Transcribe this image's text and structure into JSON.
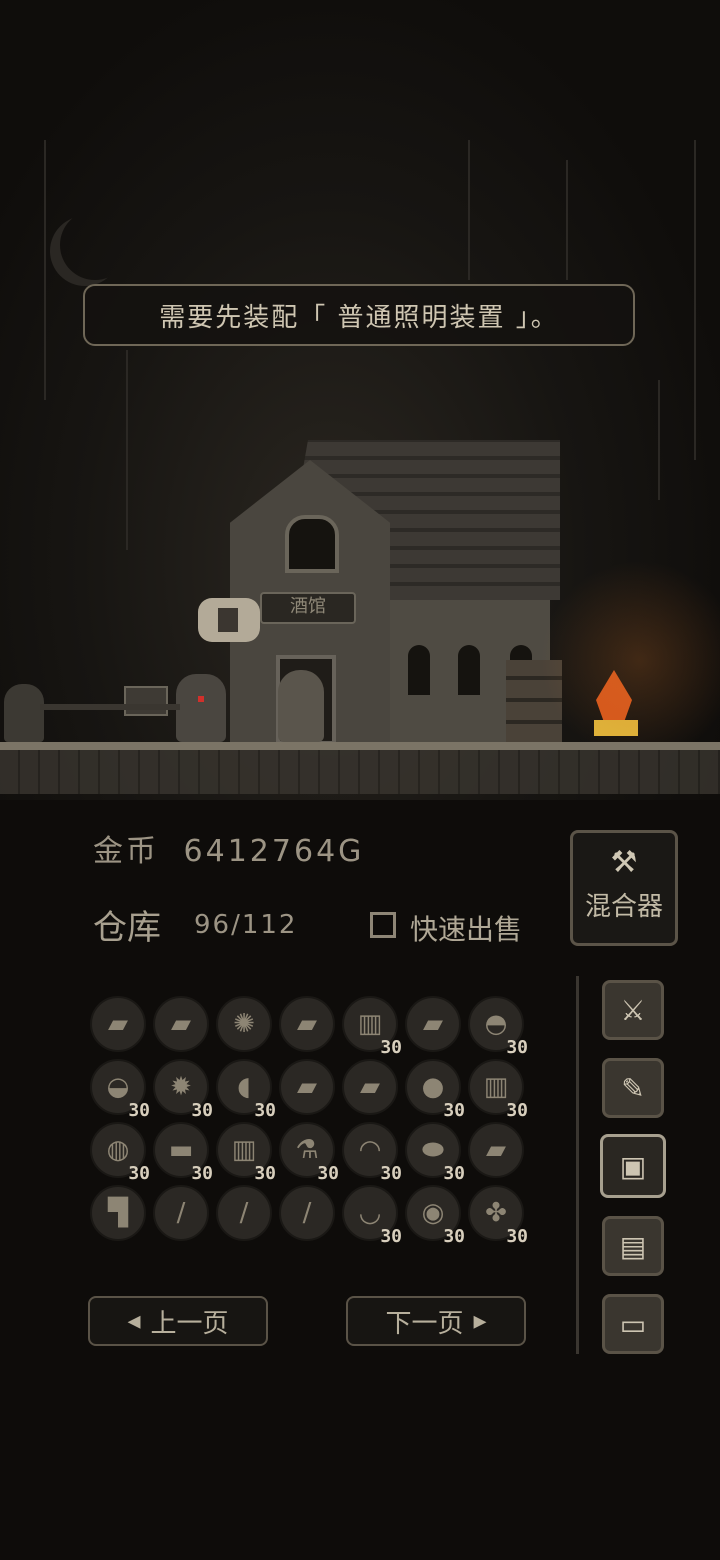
{
  "message": "需要先装配「 普通照明装置 」。",
  "tavern_sign": "酒馆",
  "gold": {
    "label": "金币",
    "value": "6412764G"
  },
  "storage": {
    "label": "仓库",
    "count": "96/112"
  },
  "quick_sell_label": "快速出售",
  "mixer": {
    "label": "混合器",
    "icon": "wrench-icon"
  },
  "slots": [
    {
      "icon": "scroll-icon",
      "qty": ""
    },
    {
      "icon": "scroll-icon",
      "qty": ""
    },
    {
      "icon": "compass-icon",
      "qty": ""
    },
    {
      "icon": "scroll-icon",
      "qty": ""
    },
    {
      "icon": "jar-icon",
      "qty": "30"
    },
    {
      "icon": "scroll-icon",
      "qty": ""
    },
    {
      "icon": "watermelon-icon",
      "qty": "30"
    },
    {
      "icon": "cake-icon",
      "qty": "30"
    },
    {
      "icon": "urchin-icon",
      "qty": "30"
    },
    {
      "icon": "croissant-icon",
      "qty": "30"
    },
    {
      "icon": "scroll-icon",
      "qty": ""
    },
    {
      "icon": "scroll-icon",
      "qty": ""
    },
    {
      "icon": "orb-icon",
      "qty": "30"
    },
    {
      "icon": "jar-icon",
      "qty": "30"
    },
    {
      "icon": "pot-icon",
      "qty": "30"
    },
    {
      "icon": "bar-icon",
      "qty": "30"
    },
    {
      "icon": "jar-icon",
      "qty": "30"
    },
    {
      "icon": "potion-icon",
      "qty": "30"
    },
    {
      "icon": "pie-icon",
      "qty": "30"
    },
    {
      "icon": "bread-icon",
      "qty": "30"
    },
    {
      "icon": "scroll-icon",
      "qty": ""
    },
    {
      "icon": "armor-icon",
      "qty": ""
    },
    {
      "icon": "sword-icon",
      "qty": ""
    },
    {
      "icon": "dagger-icon",
      "qty": ""
    },
    {
      "icon": "knife-icon",
      "qty": ""
    },
    {
      "icon": "bowl-icon",
      "qty": "30"
    },
    {
      "icon": "basket-icon",
      "qty": "30"
    },
    {
      "icon": "pineapple-icon",
      "qty": "30"
    }
  ],
  "prev_page": "上一页",
  "next_page": "下一页",
  "side_tabs": [
    "swords-icon",
    "quill-icon",
    "map-icon",
    "document-icon",
    "computer-icon"
  ],
  "active_side_tab": 2
}
